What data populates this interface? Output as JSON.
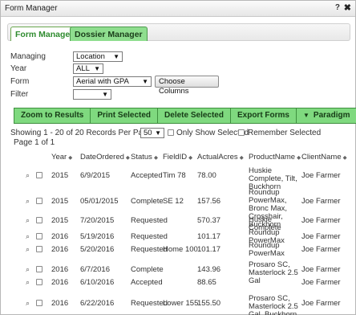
{
  "window": {
    "title": "Form Manager",
    "help_label": "?",
    "close_label": "✖"
  },
  "tabs": [
    {
      "label": "Form Manager",
      "active": true
    },
    {
      "label": "Dossier Manager",
      "active": false
    }
  ],
  "filters": {
    "managing": {
      "label": "Managing",
      "value": "Location"
    },
    "year": {
      "label": "Year",
      "value": "ALL"
    },
    "form": {
      "label": "Form",
      "value": "Aerial with GPA"
    },
    "filter": {
      "label": "Filter",
      "value": ""
    },
    "choose_columns_label": "Choose Columns"
  },
  "toolbar": {
    "zoom": "Zoom to Results",
    "print": "Print Selected",
    "delete": "Delete Selected",
    "export": "Export Forms",
    "paradigm": "Paradigm"
  },
  "paging": {
    "showing": "Showing 1 - 20 of 20 Records Per Page:",
    "per_page": "50",
    "only_show_selected": "Only Show Selected",
    "remember_selected": "Remember Selected",
    "page_info": "Page 1 of 1"
  },
  "grid": {
    "sort_glyph": "◆",
    "columns": [
      "Year",
      "DateOrdered",
      "Status",
      "FieldID",
      "ActualAcres",
      "ProductName",
      "ClientName"
    ],
    "rows": [
      {
        "year": "2015",
        "date": "6/9/2015",
        "status": "Accepted",
        "field": "Tim 78",
        "acres": "78.00",
        "product": "Huskie Complete, Tilt, Buckhorn",
        "client": "Joe Farmer"
      },
      {
        "year": "2015",
        "date": "05/01/2015",
        "status": "Complete",
        "field": "SE 12",
        "acres": "157.56",
        "product": "Roundup PowerMax, Bronc Max, Crosshair, Buckhorn",
        "client": "Joe Farmer"
      },
      {
        "year": "2015",
        "date": "7/20/2015",
        "status": "Requested",
        "field": "",
        "acres": "570.37",
        "product": "Huskie Complete",
        "client": "Joe Farmer"
      },
      {
        "year": "2016",
        "date": "5/19/2016",
        "status": "Requested",
        "field": "",
        "acres": "101.17",
        "product": "Roundup PowerMax",
        "client": "Joe Farmer"
      },
      {
        "year": "2016",
        "date": "5/20/2016",
        "status": "Requested",
        "field": "Home 100",
        "acres": "101.17",
        "product": "Roundup PowerMax",
        "client": "Joe Farmer"
      },
      {
        "year": "2016",
        "date": "6/7/2016",
        "status": "Complete",
        "field": "",
        "acres": "143.96",
        "product": "Prosaro SC, Masterlock 2.5 Gal",
        "client": "Joe Farmer"
      },
      {
        "year": "2016",
        "date": "6/10/2016",
        "status": "Accepted",
        "field": "",
        "acres": "88.65",
        "product": "",
        "client": "Joe Farmer"
      },
      {
        "year": "2016",
        "date": "6/22/2016",
        "status": "Requested",
        "field": "Lower 155",
        "acres": "155.50",
        "product": "Prosaro SC, Masterlock 2.5 Gal, Buckhorn",
        "client": "Joe Farmer"
      }
    ]
  },
  "colors": {
    "accent_green": "#7fd97f",
    "tab_green": "#2e8b2e"
  }
}
